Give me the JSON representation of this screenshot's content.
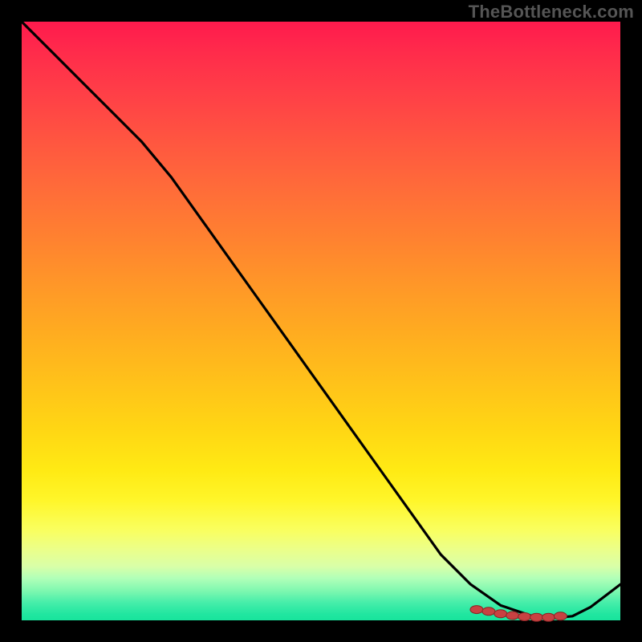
{
  "watermark": "TheBottleneck.com",
  "colors": {
    "background": "#000000",
    "line": "#000000",
    "marker_fill": "#c84242",
    "marker_stroke": "#8a2424",
    "watermark_text": "#555555"
  },
  "chart_data": {
    "type": "line",
    "title": "",
    "xlabel": "",
    "ylabel": "",
    "xlim": [
      0,
      100
    ],
    "ylim": [
      0,
      100
    ],
    "grid": false,
    "series": [
      {
        "name": "curve",
        "x": [
          0,
          5,
          10,
          15,
          20,
          25,
          30,
          35,
          40,
          45,
          50,
          55,
          60,
          65,
          70,
          75,
          80,
          85,
          88,
          92,
          95,
          100
        ],
        "y": [
          100,
          95,
          90,
          85,
          80,
          74,
          67,
          60,
          53,
          46,
          39,
          32,
          25,
          18,
          11,
          6,
          2.5,
          0.8,
          0.3,
          0.7,
          2.2,
          6
        ]
      }
    ],
    "markers": {
      "name": "highlight-cluster",
      "x": [
        76,
        78,
        80,
        82,
        84,
        86,
        88,
        90
      ],
      "y": [
        1.8,
        1.5,
        1.1,
        0.8,
        0.6,
        0.5,
        0.5,
        0.7
      ]
    }
  }
}
